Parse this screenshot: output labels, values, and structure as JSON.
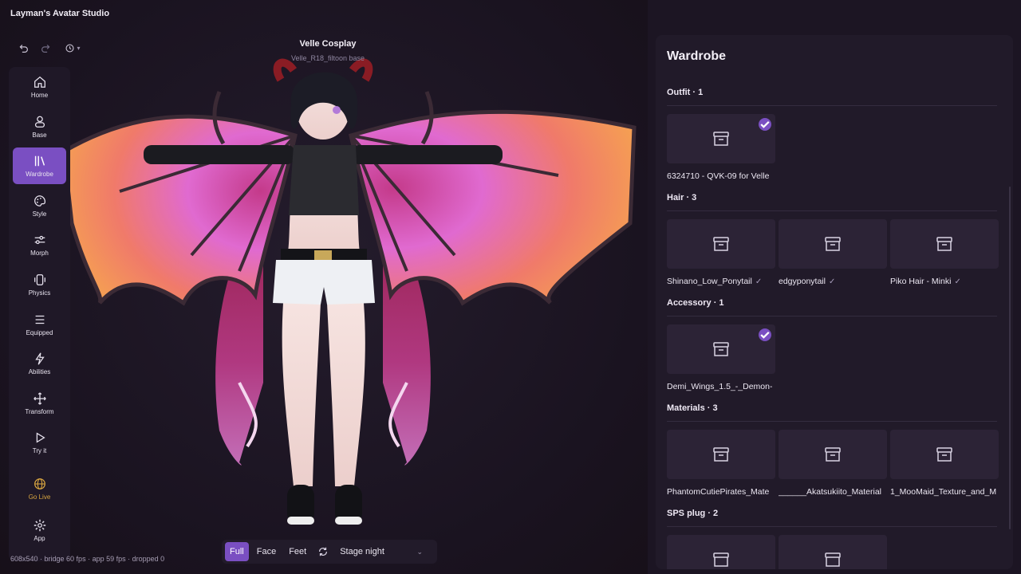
{
  "app": {
    "title": "Layman's Avatar Studio"
  },
  "window": {
    "minimize": "—",
    "maximize": "☐",
    "close": "✕"
  },
  "history": {
    "dropdown_chevron": "▾"
  },
  "rail": {
    "items": [
      {
        "label": "Home",
        "icon": "home-icon"
      },
      {
        "label": "Base",
        "icon": "person-icon"
      },
      {
        "label": "Wardrobe",
        "icon": "wardrobe-icon",
        "active": true
      },
      {
        "label": "Style",
        "icon": "palette-icon"
      },
      {
        "label": "Morph",
        "icon": "sliders-icon"
      },
      {
        "label": "Physics",
        "icon": "physics-icon"
      },
      {
        "label": "Equipped",
        "icon": "list-icon"
      },
      {
        "label": "Abilities",
        "icon": "bolt-icon"
      },
      {
        "label": "Transform",
        "icon": "move-icon"
      },
      {
        "label": "Try it",
        "icon": "play-icon"
      },
      {
        "label": "Go Live",
        "icon": "globe-icon"
      },
      {
        "label": "App",
        "icon": "gear-icon"
      }
    ]
  },
  "avatar": {
    "name": "Velle Cosplay",
    "base": "Velle_R18_filtoon base"
  },
  "status": {
    "text": "608x540 · bridge 60 fps · app 59 fps · dropped 0"
  },
  "viewbar": {
    "full": "Full",
    "face": "Face",
    "feet": "Feet",
    "stage": "Stage night",
    "stage_chevron": "⌄"
  },
  "colors": {
    "accent": "#7a4fc2",
    "golive": "#d9a640"
  },
  "wardrobe": {
    "title": "Wardrobe",
    "sections": [
      {
        "heading": "Outfit · 1",
        "items": [
          {
            "label": "6324710 - QVK-09 for Velle",
            "checked": true,
            "ok": ""
          }
        ]
      },
      {
        "heading": "Hair · 3",
        "items": [
          {
            "label": "Shinano_Low_Ponytail",
            "checked": false,
            "ok": "✓"
          },
          {
            "label": "edgyponytail",
            "checked": false,
            "ok": "✓"
          },
          {
            "label": "Piko Hair - Minki",
            "checked": false,
            "ok": "✓"
          }
        ]
      },
      {
        "heading": "Accessory · 1",
        "items": [
          {
            "label": "Demi_Wings_1.5_-_Demon-",
            "checked": true,
            "ok": ""
          }
        ]
      },
      {
        "heading": "Materials · 3",
        "items": [
          {
            "label": "PhantomCutiePirates_Mate",
            "checked": false,
            "ok": ""
          },
          {
            "label": "______Akatsukiito_Material",
            "checked": false,
            "ok": ""
          },
          {
            "label": "1_MooMaid_Texture_and_M",
            "checked": false,
            "ok": ""
          }
        ]
      },
      {
        "heading": "SPS plug · 2",
        "items": [
          {
            "label": "",
            "checked": false,
            "ok": ""
          },
          {
            "label": "",
            "checked": false,
            "ok": ""
          }
        ]
      }
    ]
  }
}
